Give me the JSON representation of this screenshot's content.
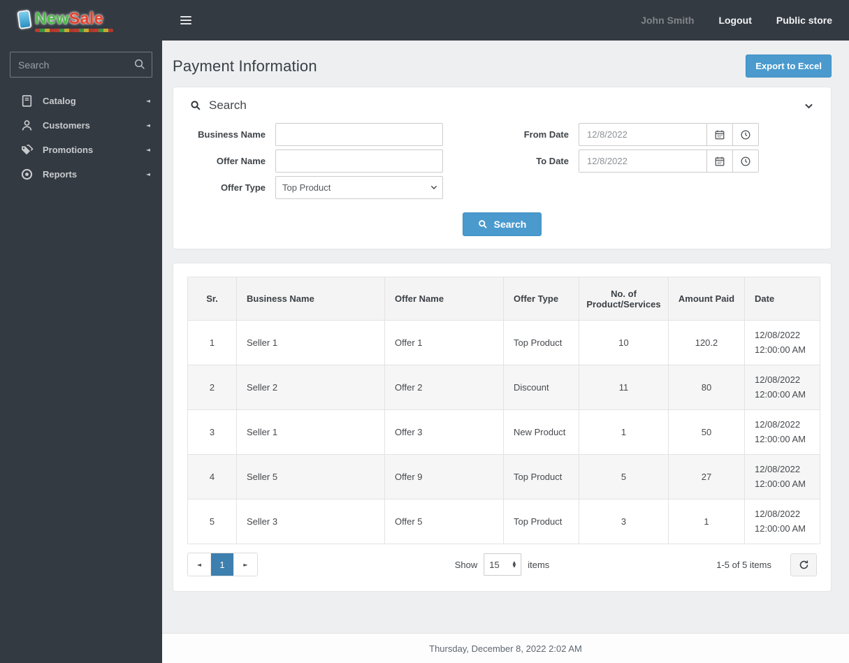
{
  "brand": {
    "logo_new": "New",
    "logo_sale": "Sale"
  },
  "sidebar": {
    "search_placeholder": "Search",
    "items": [
      {
        "label": "Catalog"
      },
      {
        "label": "Customers"
      },
      {
        "label": "Promotions"
      },
      {
        "label": "Reports"
      }
    ]
  },
  "topbar": {
    "user": "John Smith",
    "logout": "Logout",
    "public_store": "Public store"
  },
  "page": {
    "title": "Payment Information",
    "export_button": "Export to Excel"
  },
  "search_panel": {
    "title": "Search",
    "business_name_label": "Business Name",
    "business_name_value": "",
    "offer_name_label": "Offer Name",
    "offer_name_value": "",
    "offer_type_label": "Offer Type",
    "offer_type_value": "Top Product",
    "from_date_label": "From Date",
    "from_date_value": "12/8/2022",
    "to_date_label": "To Date",
    "to_date_value": "12/8/2022",
    "search_button": "Search"
  },
  "table": {
    "headers": [
      "Sr.",
      "Business Name",
      "Offer Name",
      "Offer Type",
      "No. of Product/Services",
      "Amount Paid",
      "Date"
    ],
    "rows": [
      {
        "sr": "1",
        "business_name": "Seller 1",
        "offer_name": "Offer 1",
        "offer_type": "Top Product",
        "count": "10",
        "amount": "120.2",
        "date": "12/08/2022",
        "time": "12:00:00 AM"
      },
      {
        "sr": "2",
        "business_name": "Seller 2",
        "offer_name": "Offer 2",
        "offer_type": "Discount",
        "count": "11",
        "amount": "80",
        "date": "12/08/2022",
        "time": "12:00:00 AM"
      },
      {
        "sr": "3",
        "business_name": "Seller 1",
        "offer_name": "Offer 3",
        "offer_type": "New Product",
        "count": "1",
        "amount": "50",
        "date": "12/08/2022",
        "time": "12:00:00 AM"
      },
      {
        "sr": "4",
        "business_name": "Seller 5",
        "offer_name": "Offer 9",
        "offer_type": "Top Product",
        "count": "5",
        "amount": "27",
        "date": "12/08/2022",
        "time": "12:00:00 AM"
      },
      {
        "sr": "5",
        "business_name": "Seller 3",
        "offer_name": "Offer 5",
        "offer_type": "Top Product",
        "count": "3",
        "amount": "1",
        "date": "12/08/2022",
        "time": "12:00:00 AM"
      }
    ]
  },
  "pagination": {
    "current_page": "1",
    "show_label": "Show",
    "page_size": "15",
    "items_label": "items",
    "range_label": "1-5 of 5 items"
  },
  "footer": {
    "datetime": "Thursday, December 8, 2022 2:02 AM"
  },
  "icons": {
    "pager_prev": "◄",
    "pager_next": "►",
    "menu_collapse": "◄",
    "spinner_up": "▲",
    "spinner_down": "▼"
  },
  "colors": {
    "accent_blue": "#4a9ace",
    "active_page_blue": "#3d7fae",
    "sidebar_bg": "#343a41",
    "content_bg": "#edeff1"
  }
}
